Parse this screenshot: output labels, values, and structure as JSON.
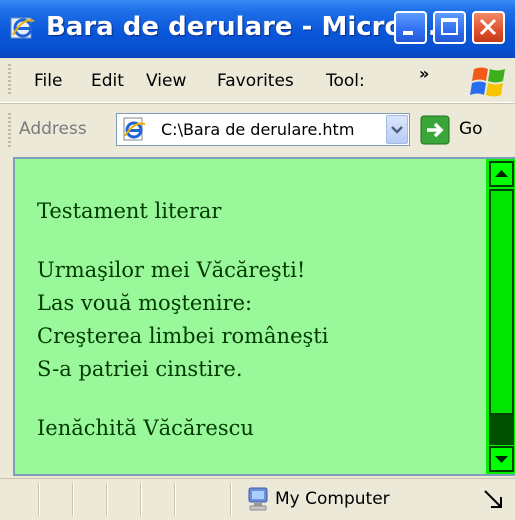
{
  "window": {
    "title": "Bara de derulare - Micros..."
  },
  "menu": {
    "items": [
      "File",
      "Edit",
      "View",
      "Favorites",
      "Tool:"
    ],
    "overflow": "»"
  },
  "address": {
    "label": "Address",
    "value": "C:\\Bara de derulare.htm",
    "go_label": "Go"
  },
  "content": {
    "background": "#99f899",
    "text_color": "#003a00",
    "lines": {
      "title": "Testament literar",
      "l1": "Urmaşilor mei Văcăreşti!",
      "l2": "Las vouă moştenire:",
      "l3": "Creşterea limbei româneşti",
      "l4": "S-a patriei cinstire.",
      "author": "Ienăchită Văcărescu"
    }
  },
  "scrollbar": {
    "track_color": "#00f000",
    "position": 0
  },
  "status": {
    "zone_label": "My Computer"
  },
  "colors": {
    "titlebar": "#0a57da",
    "chrome": "#ece9d8"
  }
}
